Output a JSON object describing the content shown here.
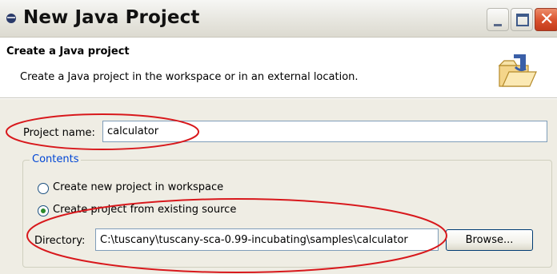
{
  "window": {
    "title": "New Java Project",
    "controls": {
      "minimize": "minimize",
      "maximize": "maximize",
      "close": "close"
    }
  },
  "header": {
    "title": "Create a Java project",
    "description": "Create a Java project in the workspace or in an external location."
  },
  "form": {
    "project_name_label": "Project name:",
    "project_name_value": "calculator",
    "contents": {
      "legend": "Contents",
      "options": [
        {
          "label": "Create new project in workspace",
          "selected": false
        },
        {
          "label": "Create project from existing source",
          "selected": true
        }
      ],
      "directory_label": "Directory:",
      "directory_value": "C:\\tuscany\\tuscany-sca-0.99-incubating\\samples\\calculator",
      "browse_label": "Browse..."
    }
  },
  "colors": {
    "annotation": "#d8181c",
    "group_legend": "#0046d5"
  }
}
